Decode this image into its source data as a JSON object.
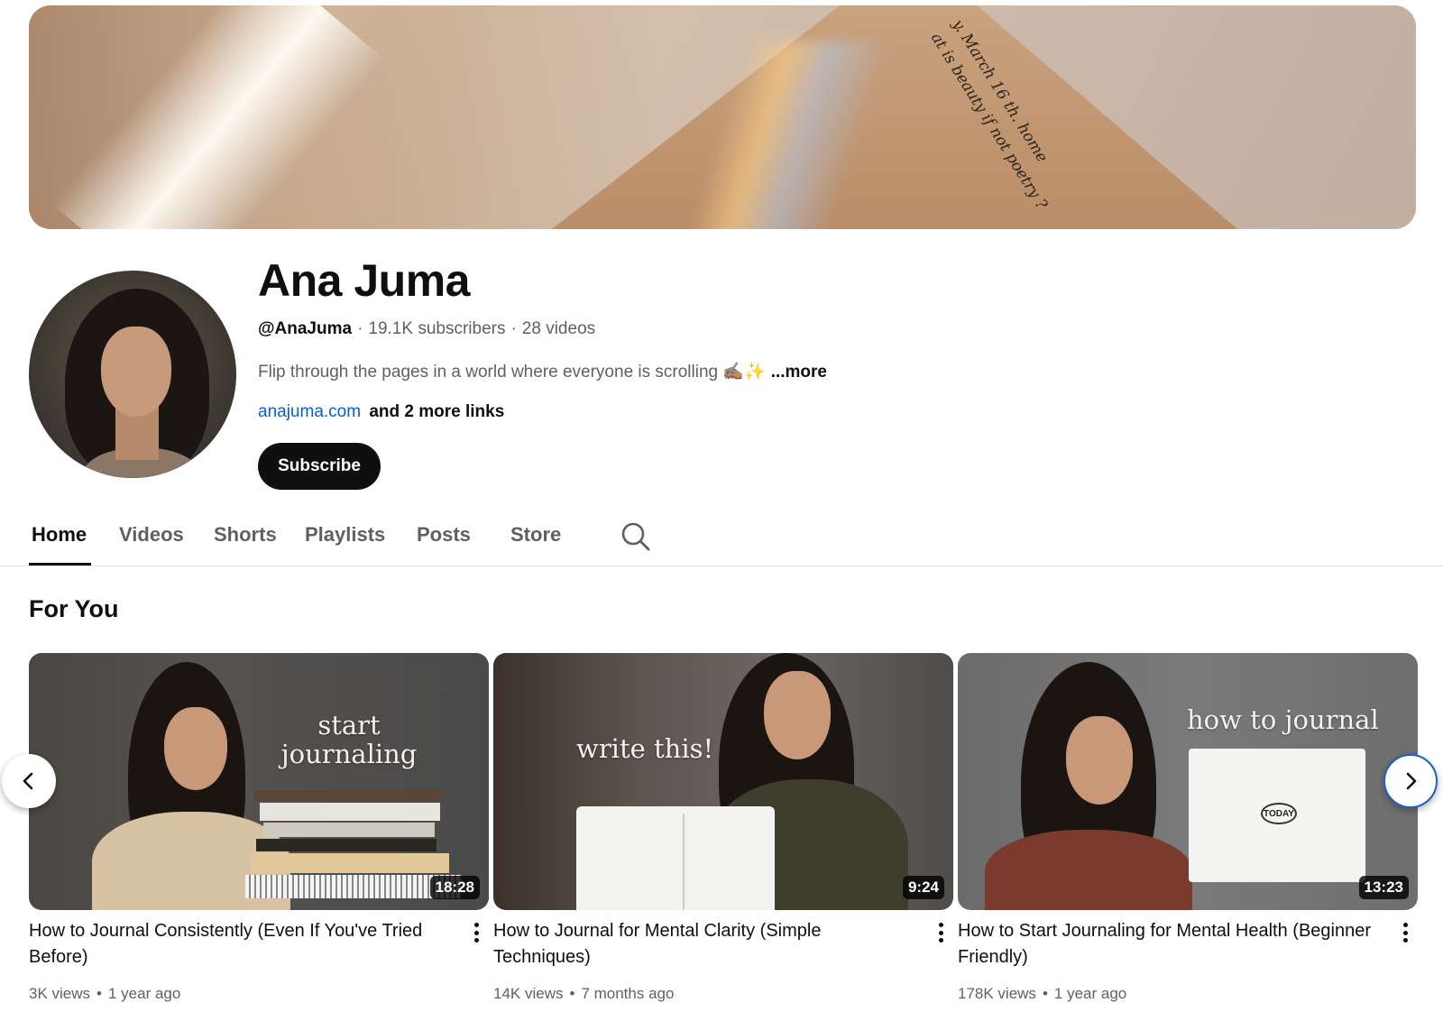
{
  "banner": {
    "handwriting_line1": "y. March 16 th. home",
    "handwriting_line2": "at is beauty if not poetry ?"
  },
  "channel": {
    "name": "Ana Juma",
    "handle": "@AnaJuma",
    "subscribers": "19.1K subscribers",
    "videos": "28 videos",
    "description": "Flip through the pages in a world where everyone is scrolling ✍🏽✨",
    "more_label": "...more",
    "link": "anajuma.com",
    "more_links": "and 2 more links",
    "subscribe_label": "Subscribe"
  },
  "tabs": [
    {
      "label": "Home",
      "active": true
    },
    {
      "label": "Videos"
    },
    {
      "label": "Shorts"
    },
    {
      "label": "Playlists"
    },
    {
      "label": "Posts"
    },
    {
      "label": "Store"
    }
  ],
  "section": {
    "title": "For You"
  },
  "videos": [
    {
      "title": "How to Journal Consistently (Even If You've Tried Before)",
      "duration": "18:28",
      "views": "3K views",
      "age": "1 year ago",
      "thumb_caption_1": "start",
      "thumb_caption_2": "journaling"
    },
    {
      "title": "How to Journal for Mental Clarity (Simple Techniques)",
      "duration": "9:24",
      "views": "14K views",
      "age": "7 months ago",
      "thumb_caption_1": "write this!"
    },
    {
      "title": "How to Start Journaling for Mental Health (Beginner Friendly)",
      "duration": "13:23",
      "views": "178K views",
      "age": "1 year ago",
      "thumb_caption_1": "how to journal",
      "thumb_mindmap_label": "TODAY"
    }
  ],
  "meta_separator": "·",
  "card_separator": "•",
  "colors": {
    "link": "#065fd4",
    "text": "#0f0f0f",
    "secondary": "#606060",
    "focus_ring": "#1f5fbf"
  },
  "icons": {
    "search": "search-icon",
    "prev": "chevron-left-icon",
    "next": "chevron-right-icon",
    "more": "more-vertical-icon"
  }
}
